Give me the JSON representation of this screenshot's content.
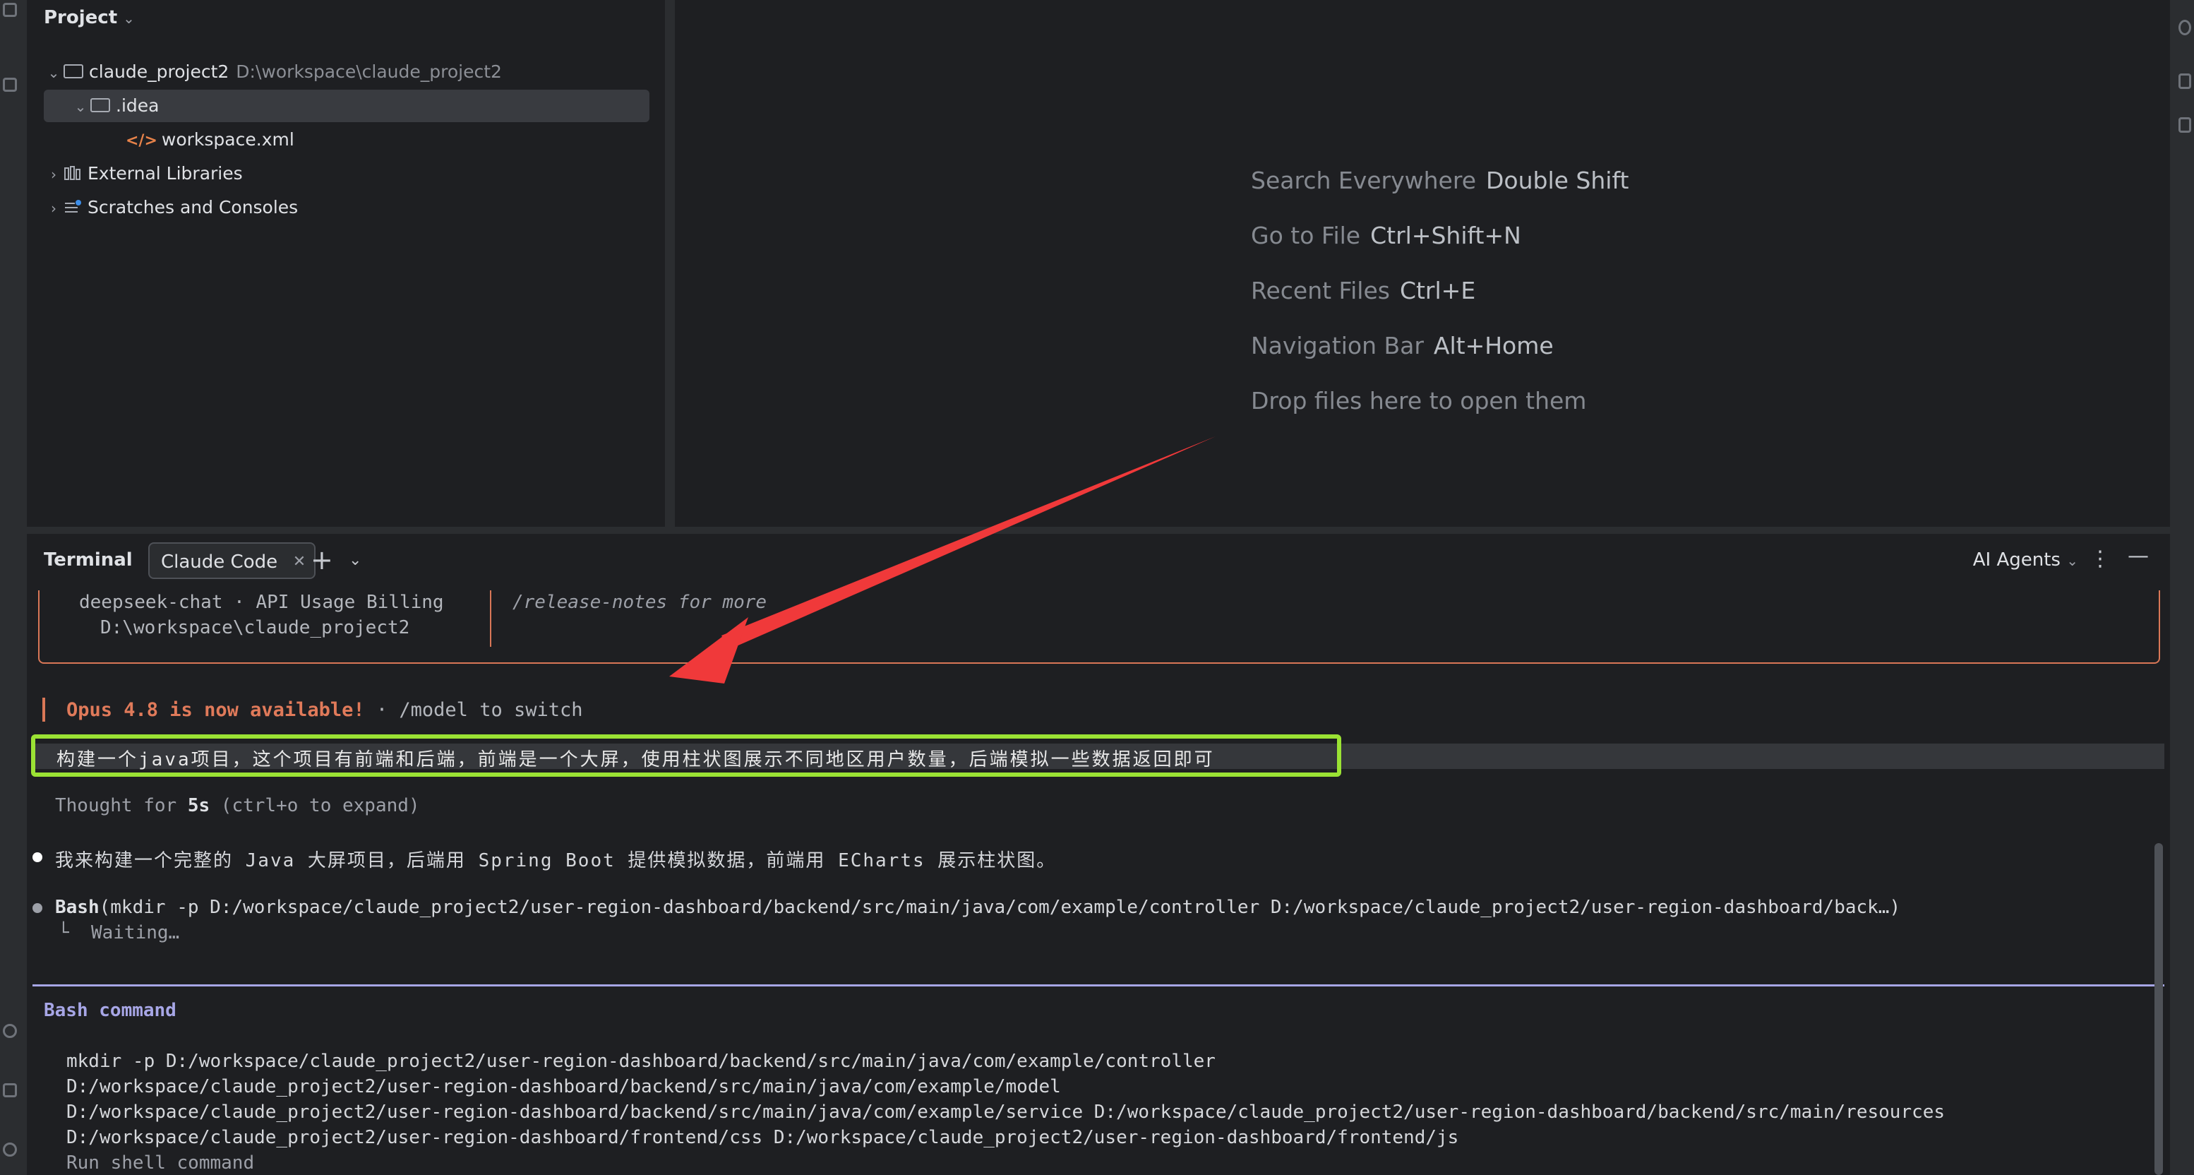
{
  "project": {
    "header": "Project",
    "tree": [
      {
        "label": "claude_project2",
        "path": "D:\\workspace\\claude_project2",
        "expanded": true
      },
      {
        "label": ".idea",
        "expanded": true,
        "selected": true
      },
      {
        "label": "workspace.xml"
      },
      {
        "label": "External Libraries",
        "expanded": false
      },
      {
        "label": "Scratches and Consoles",
        "expanded": false
      }
    ]
  },
  "editor": {
    "hints": [
      {
        "label": "Search Everywhere",
        "key": "Double Shift"
      },
      {
        "label": "Go to File",
        "key": "Ctrl+Shift+N"
      },
      {
        "label": "Recent Files",
        "key": "Ctrl+E"
      },
      {
        "label": "Navigation Bar",
        "key": "Alt+Home"
      },
      {
        "label": "Drop files here to open them",
        "key": ""
      }
    ]
  },
  "terminal": {
    "title": "Terminal",
    "tab_label": "Claude Code",
    "ai_agents": "AI Agents",
    "welcome": {
      "model_line": "deepseek-chat · API Usage Billing",
      "path_line": "D:\\workspace\\claude_project2",
      "release_notes": "/release-notes for more"
    },
    "opus_highlight": "Opus 4.8 is now available!",
    "opus_rest": " · /model to switch",
    "prompt": "构建一个java项目，这个项目有前端和后端，前端是一个大屏，使用柱状图展示不同地区用户数量，后端模拟一些数据返回即可",
    "thought": "Thought for ",
    "thought_bold": "5s",
    "thought_rest": " (ctrl+o to expand)",
    "response": "我来构建一个完整的 Java 大屏项目，后端用 Spring Boot 提供模拟数据，前端用 ECharts 展示柱状图。",
    "bash_line_prefix": "Bash",
    "bash_line": "(mkdir -p D:/workspace/claude_project2/user-region-dashboard/backend/src/main/java/com/example/controller D:/workspace/claude_project2/user-region-dashboard/back…)",
    "waiting": "└  Waiting…",
    "bash_command_title": "Bash command",
    "command_lines": [
      "mkdir -p D:/workspace/claude_project2/user-region-dashboard/backend/src/main/java/com/example/controller",
      "D:/workspace/claude_project2/user-region-dashboard/backend/src/main/java/com/example/model",
      "D:/workspace/claude_project2/user-region-dashboard/backend/src/main/java/com/example/service D:/workspace/claude_project2/user-region-dashboard/backend/src/main/resources",
      "D:/workspace/claude_project2/user-region-dashboard/frontend/css D:/workspace/claude_project2/user-region-dashboard/frontend/js",
      "Run shell command"
    ]
  },
  "colors": {
    "accent_orange": "#d97757",
    "highlight_green": "#9be234",
    "arrow_red": "#f0393a",
    "command_purple": "#a7a6e6"
  }
}
